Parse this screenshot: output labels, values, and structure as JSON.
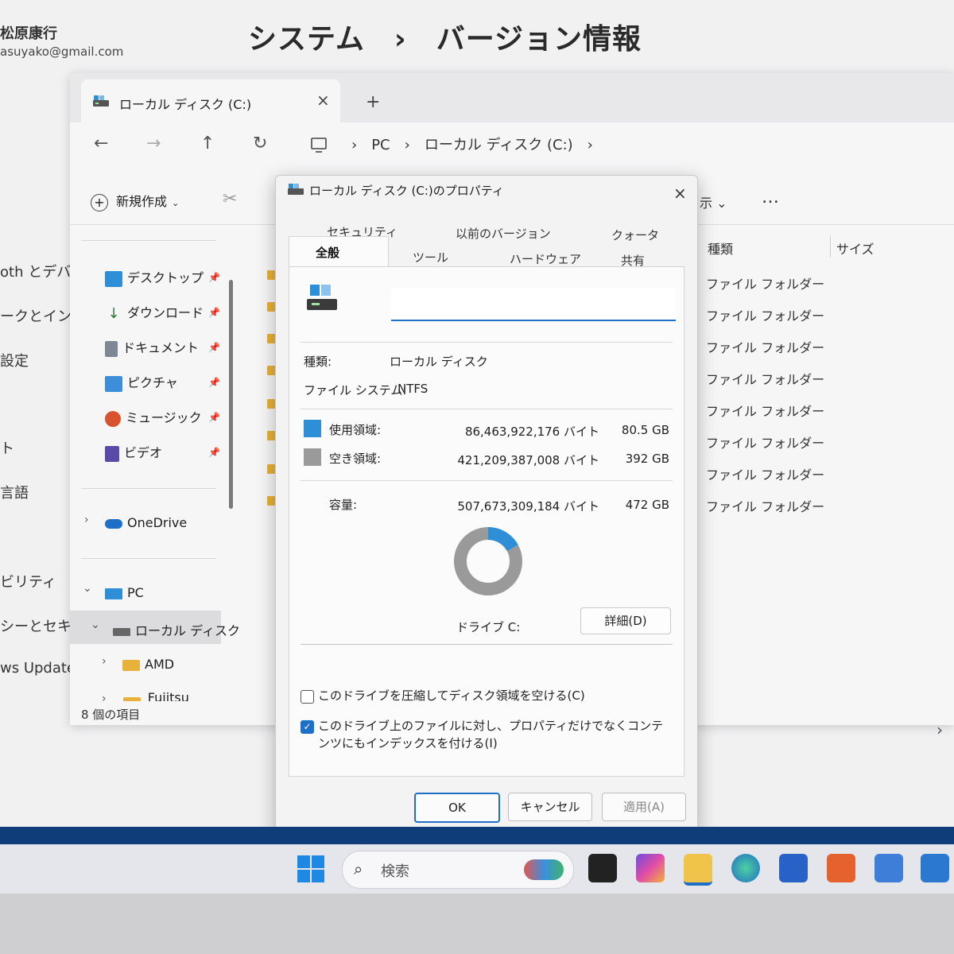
{
  "settings": {
    "user_name": "松原康行",
    "user_email": "asuyako@gmail.com",
    "breadcrumb": "システム　›　バージョン情報",
    "nav": [
      "oth とデバイ",
      "ークとインター",
      "設定",
      "ト",
      "言語",
      "ビリティ",
      "シーとセキュリ",
      "ws Update"
    ]
  },
  "explorer": {
    "tab_title": "ローカル ディスク (C:)",
    "tab_close": "×",
    "new_tab": "+",
    "nav": {
      "back": "←",
      "forward": "→",
      "up": "↑",
      "refresh": "↻"
    },
    "address": "PC　›　ローカル ディスク (C:)　›",
    "address_sep": "›",
    "new_button": "新規作成",
    "view_label": "示 ⌄",
    "more": "…",
    "sidebar": [
      {
        "label": "デスクトップ",
        "icon": "desktop-icon"
      },
      {
        "label": "ダウンロード",
        "icon": "download-icon"
      },
      {
        "label": "ドキュメント",
        "icon": "document-icon"
      },
      {
        "label": "ピクチャ",
        "icon": "picture-icon"
      },
      {
        "label": "ミュージック",
        "icon": "music-icon"
      },
      {
        "label": "ビデオ",
        "icon": "video-icon"
      }
    ],
    "onedrive": "OneDrive",
    "pc": "PC",
    "local_disk": "ローカル ディスク",
    "amd": "AMD",
    "fujitsu": "Fujitsu",
    "status": "8 個の項目",
    "columns": {
      "type": "種類",
      "size": "サイズ"
    },
    "folder_type": "ファイル フォルダー",
    "folder_count": 8
  },
  "dialog": {
    "title": "ローカル ディスク (C:)のプロパティ",
    "close": "×",
    "tabs_row1": [
      "セキュリティ",
      "以前のバージョン",
      "クォータ"
    ],
    "tabs_row2": [
      "全般",
      "ツール",
      "ハードウェア",
      "共有"
    ],
    "type_label": "種類:",
    "type_value": "ローカル ディスク",
    "fs_label": "ファイル システム:",
    "fs_value": "NTFS",
    "used_label": "使用領域:",
    "used_bytes": "86,463,922,176 バイト",
    "used_gb": "80.5 GB",
    "free_label": "空き領域:",
    "free_bytes": "421,209,387,008 バイト",
    "free_gb": "392 GB",
    "capacity_label": "容量:",
    "capacity_bytes": "507,673,309,184 バイト",
    "capacity_gb": "472 GB",
    "used_fraction": 0.17,
    "drive_label": "ドライブ C:",
    "details_button": "詳細(D)",
    "compress_label": "このドライブを圧縮してディスク領域を空ける(C)",
    "index_label": "このドライブ上のファイルに対し、プロパティだけでなくコンテンツにもインデックスを付ける(I)",
    "ok": "OK",
    "cancel": "キャンセル",
    "apply": "適用(A)",
    "colors": {
      "used": "#2f8fd6",
      "free": "#9a9a9a"
    }
  },
  "taskbar": {
    "search_placeholder": "検索"
  }
}
